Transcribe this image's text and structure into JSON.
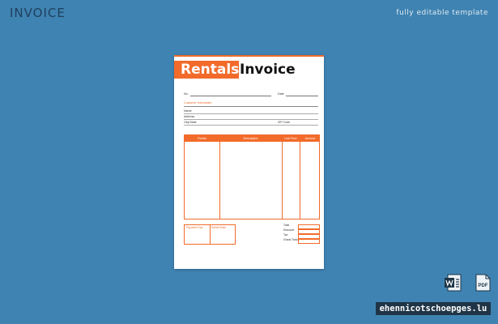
{
  "page": {
    "title": "INVOICE",
    "subtitle": "fully editable template"
  },
  "invoice": {
    "brand": "Rentals",
    "title_rest": "Invoice",
    "no_label": "No.",
    "date_label": "Date",
    "customer_header": "Customer Information",
    "customer_fields": [
      "Name",
      "Address",
      "City/State"
    ],
    "email_label": "ZIP Code",
    "table_headers": [
      "Rental",
      "Description",
      "Unit Price",
      "Amount"
    ],
    "bottom_left_labels": [
      "Payment Due",
      "Rental Date"
    ],
    "summary_labels": [
      "Total",
      "Discount",
      "Tax",
      "Grand Total"
    ]
  },
  "files": {
    "word_icon": "word-file-icon",
    "pdf_icon": "pdf-file-icon",
    "pdf_label": "PDF"
  },
  "watermark": "ehennicotschoepges.lu",
  "colors": {
    "background": "#3f83b2",
    "accent": "#f26b2a",
    "watermark_bg": "#1f3547"
  }
}
